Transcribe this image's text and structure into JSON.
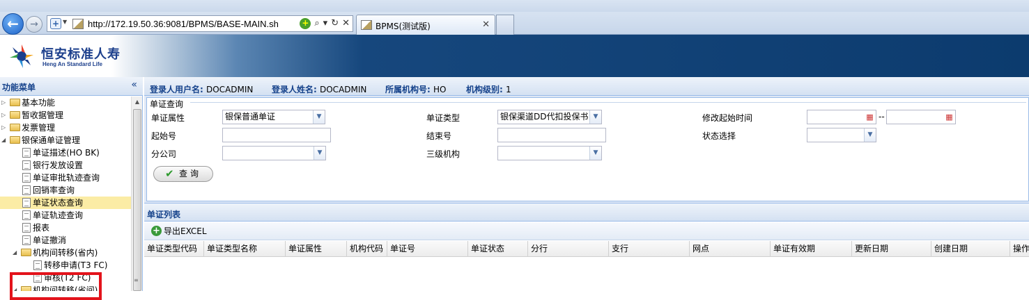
{
  "browser": {
    "url": "http://172.19.50.36:9081/BPMS/BASE-MAIN.sh",
    "tab_title": "BPMS(测试版)",
    "tab_close": "✕",
    "back_glyph": "←",
    "forward_glyph": "→",
    "search_glyph": "⌕",
    "refresh_glyph": "↻",
    "stop_glyph": "✕"
  },
  "app": {
    "brand_cn": "恒安标准人寿",
    "brand_en": "Heng An Standard Life",
    "colors": {
      "header_dark": "#0c3b6e",
      "panel_blue": "#15428b",
      "selected_row": "#fbeca5",
      "highlight_box": "#e3131b"
    }
  },
  "sidebar": {
    "title": "功能菜单",
    "collapse_glyph": "«",
    "tree": [
      {
        "label": "基本功能",
        "level": 0,
        "type": "folder",
        "expanded": false
      },
      {
        "label": "暂收据管理",
        "level": 0,
        "type": "folder",
        "expanded": false
      },
      {
        "label": "发票管理",
        "level": 0,
        "type": "folder",
        "expanded": false
      },
      {
        "label": "银保通单证管理",
        "level": 0,
        "type": "folder",
        "expanded": true
      },
      {
        "label": "单证描述(HO BK)",
        "level": 1,
        "type": "doc"
      },
      {
        "label": "银行发放设置",
        "level": 1,
        "type": "doc"
      },
      {
        "label": "单证审批轨迹查询",
        "level": 1,
        "type": "doc"
      },
      {
        "label": "回销率查询",
        "level": 1,
        "type": "doc"
      },
      {
        "label": "单证状态查询",
        "level": 1,
        "type": "doc",
        "selected": true
      },
      {
        "label": "单证轨迹查询",
        "level": 1,
        "type": "doc"
      },
      {
        "label": "报表",
        "level": 1,
        "type": "doc"
      },
      {
        "label": "单证撤消",
        "level": 1,
        "type": "doc"
      },
      {
        "label": "机构间转移(省内)",
        "level": 1,
        "type": "folder",
        "expanded": true
      },
      {
        "label": "转移申请(T3 FC)",
        "level": 2,
        "type": "doc"
      },
      {
        "label": "审核(T2 FC)",
        "level": 2,
        "type": "doc"
      },
      {
        "label": "机构间转移(省间)",
        "level": 1,
        "type": "folder",
        "expanded": true
      }
    ]
  },
  "info_bar": {
    "user_id_label": "登录人用户名:",
    "user_id": "DOCADMIN",
    "user_name_label": "登录人姓名:",
    "user_name": "DOCADMIN",
    "org_label": "所属机构号:",
    "org": "HO",
    "level_label": "机构级别:",
    "level": "1"
  },
  "query": {
    "title": "单证查询",
    "doc_attr_label": "单证属性",
    "doc_attr_value": "银保普通单证",
    "doc_type_label": "单证类型",
    "doc_type_value": "银保渠道DD代扣投保书",
    "modify_start_label": "修改起始时间",
    "modify_start_value": "",
    "modify_end_value": "",
    "range_dash": "--",
    "start_no_label": "起始号",
    "start_no_value": "",
    "end_no_label": "结束号",
    "end_no_value": "",
    "status_label": "状态选择",
    "status_value": "",
    "branch_label": "分公司",
    "branch_value": "",
    "level3_label": "三级机构",
    "level3_value": "",
    "query_button": "查询"
  },
  "list": {
    "title": "单证列表",
    "export_button": "导出EXCEL",
    "columns": [
      "单证类型代码",
      "单证类型名称",
      "单证属性",
      "机构代码",
      "单证号",
      "单证状态",
      "分行",
      "支行",
      "网点",
      "单证有效期",
      "更新日期",
      "创建日期",
      "操作"
    ]
  }
}
